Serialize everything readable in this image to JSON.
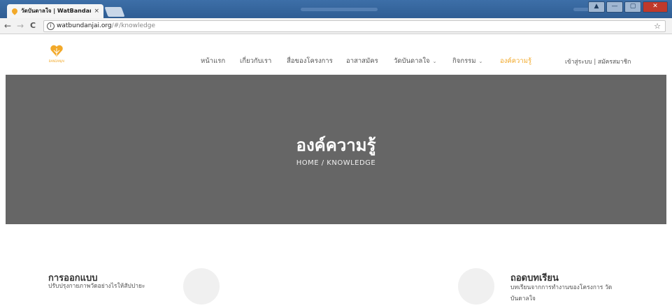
{
  "browser": {
    "tab_title": "วัดบันดาลใจ | WatBandanj",
    "tab_close": "×",
    "url_host": "watbundanjai.org",
    "url_path": "/#/knowledge",
    "back": "←",
    "forward": "→",
    "reload": "C",
    "bookmark": "☆",
    "window_controls": [
      "▲",
      "—",
      "▢",
      "✕"
    ]
  },
  "site": {
    "brand_color": "#f2a92a",
    "logo_caption": "BANDANJAI",
    "nav": [
      {
        "label": "หน้าแรก",
        "dropdown": false,
        "active": false
      },
      {
        "label": "เกี่ยวกับเรา",
        "dropdown": false,
        "active": false
      },
      {
        "label": "สื่อของโครงการ",
        "dropdown": false,
        "active": false
      },
      {
        "label": "อาสาสมัคร",
        "dropdown": false,
        "active": false
      },
      {
        "label": "วัดบันดาลใจ",
        "dropdown": true,
        "active": false
      },
      {
        "label": "กิจกรรม",
        "dropdown": true,
        "active": false
      },
      {
        "label": "องค์ความรู้",
        "dropdown": false,
        "active": true
      }
    ],
    "caret": "⌄",
    "login": "เข้าสู่ระบบ",
    "separator": "|",
    "register": "สมัครสมาชิก"
  },
  "banner": {
    "title": "องค์ความรู้",
    "breadcrumb_home": "HOME /",
    "breadcrumb_current": "KNOWLEDGE",
    "bg_color": "#666666"
  },
  "features": [
    {
      "title": "การออกแบบ",
      "desc": "ปรับปรุงกายภาพวัดอย่างไรให้สัปปายะ"
    },
    {
      "title": "ถอดบทเรียน",
      "desc": "บทเรียนจากการทำงานของโครงการ วัดบันดาลใจ"
    }
  ]
}
